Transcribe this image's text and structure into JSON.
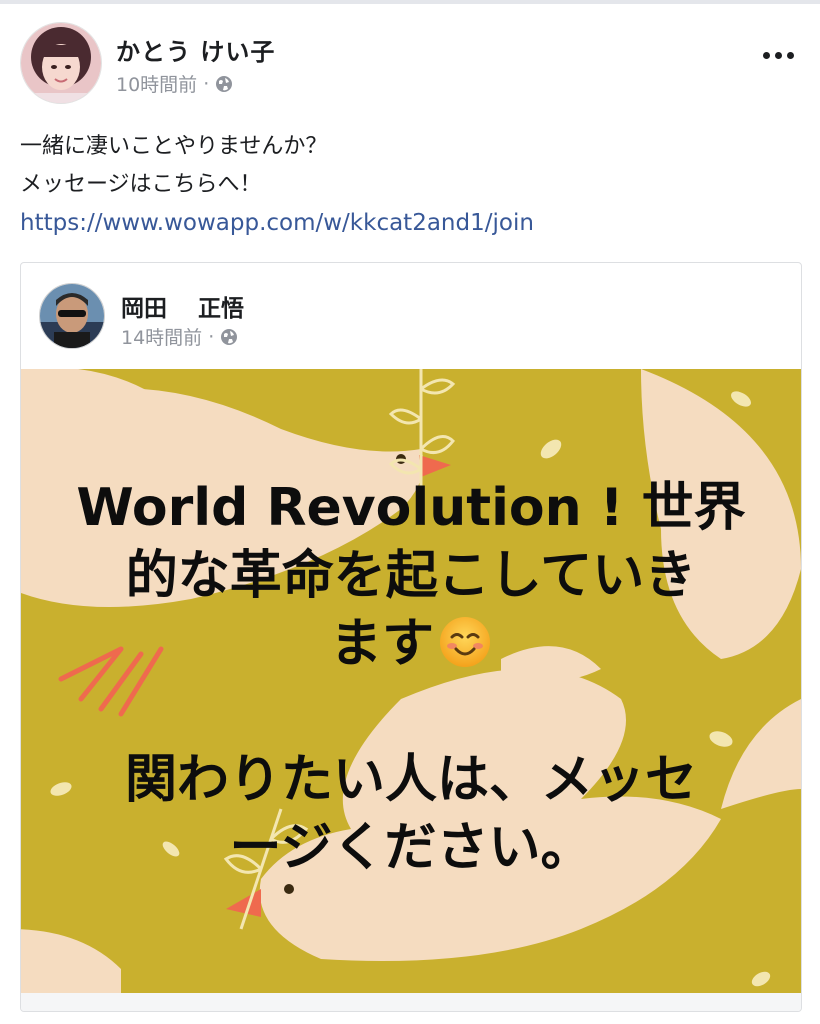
{
  "post": {
    "author": "かとう けい子",
    "time": "10時間前",
    "separator": "·",
    "privacy_icon": "globe-icon",
    "more_icon": "more-options-icon",
    "text_line1": "一緒に凄いことやりませんか？",
    "text_line2": "メッセージはこちらへ！",
    "link": "https://www.wowapp.com/w/kkcat2and1/join"
  },
  "shared_post": {
    "author": "岡田　 正悟",
    "time": "14時間前",
    "separator": "·",
    "privacy_icon": "globe-icon",
    "image_text": {
      "line1": "World Revolution ! 世界",
      "line2": "的な革命を起こしていき",
      "line3": "ます",
      "line3_emoji": "smiling-face-emoji",
      "line4": "関わりたい人は、メッセ",
      "line5": "ージください。"
    },
    "colors": {
      "background": "#c9b02e",
      "bird": "#f5dcc0",
      "beak": "#ef6a4e"
    }
  },
  "colors": {
    "link": "#385898",
    "meta": "#90949c",
    "text": "#1c1e21"
  }
}
